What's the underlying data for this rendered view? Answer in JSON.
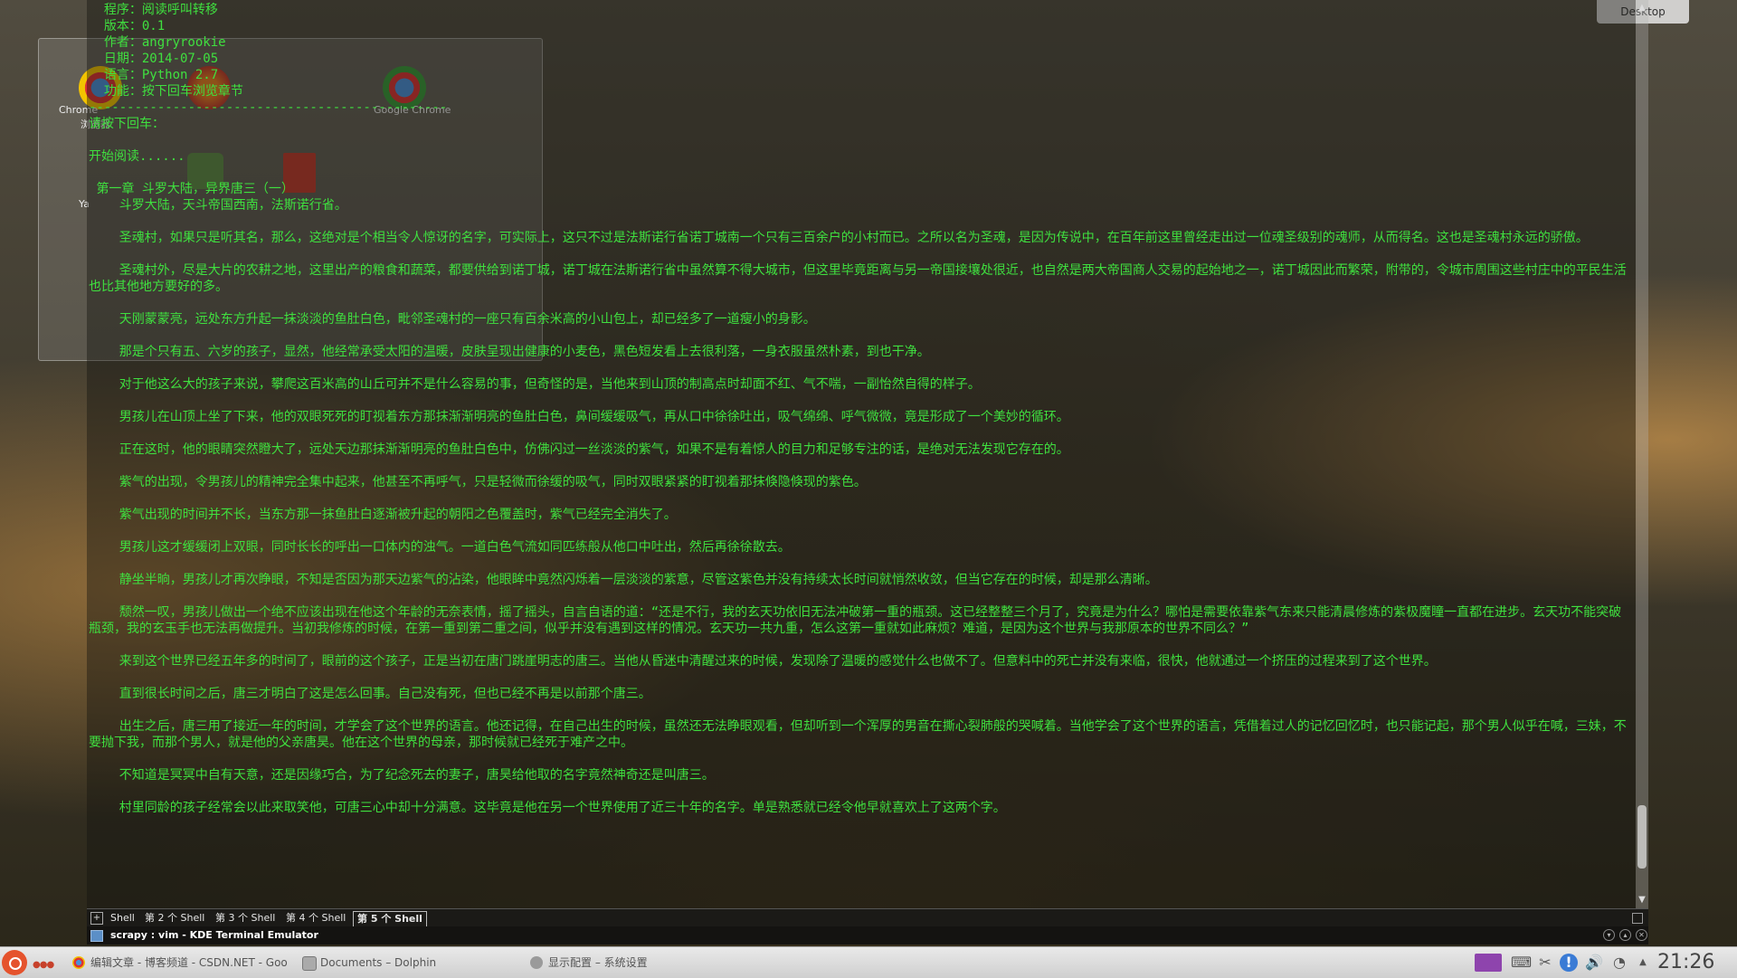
{
  "desktop": {
    "folder_view_labels": [
      "Chrome",
      "浏览器",
      "Ya",
      "Google Chrome"
    ],
    "plasmoid_label": "Desktop"
  },
  "terminal": {
    "lines": [
      "  程序：阅读呼叫转移",
      "  版本：0.1",
      "  作者：angryrookie",
      "  日期：2014-07-05",
      "  语言：Python 2.7",
      "  功能：按下回车浏览章节",
      "-----------------------------------------------",
      "请按下回车：",
      "",
      "开始阅读......",
      "",
      " 第一章 斗罗大陆，异界唐三（一）",
      "    斗罗大陆，天斗帝国西南，法斯诺行省。",
      "",
      "    圣魂村，如果只是听其名，那么，这绝对是个相当令人惊讶的名字，可实际上，这只不过是法斯诺行省诺丁城南一个只有三百余户的小村而已。之所以名为圣魂，是因为传说中，在百年前这里曾经走出过一位魂圣级别的魂师，从而得名。这也是圣魂村永远的骄傲。",
      "",
      "    圣魂村外，尽是大片的农耕之地，这里出产的粮食和蔬菜，都要供给到诺丁城，诺丁城在法斯诺行省中虽然算不得大城市，但这里毕竟距离与另一帝国接壤处很近，也自然是两大帝国商人交易的起始地之一，诺丁城因此而繁荣，附带的，令城市周围这些村庄中的平民生活也比其他地方要好的多。",
      "",
      "    天刚蒙蒙亮，远处东方升起一抹淡淡的鱼肚白色，毗邻圣魂村的一座只有百余米高的小山包上，却已经多了一道瘦小的身影。",
      "",
      "    那是个只有五、六岁的孩子，显然，他经常承受太阳的温暖，皮肤呈现出健康的小麦色，黑色短发看上去很利落，一身衣服虽然朴素，到也干净。",
      "",
      "    对于他这么大的孩子来说，攀爬这百米高的山丘可并不是什么容易的事，但奇怪的是，当他来到山顶的制高点时却面不红、气不喘，一副怡然自得的样子。",
      "",
      "    男孩儿在山顶上坐了下来，他的双眼死死的盯视着东方那抹渐渐明亮的鱼肚白色，鼻间缓缓吸气，再从口中徐徐吐出，吸气绵绵、呼气微微，竟是形成了一个美妙的循环。",
      "",
      "    正在这时，他的眼睛突然瞪大了，远处天边那抹渐渐明亮的鱼肚白色中，仿佛闪过一丝淡淡的紫气，如果不是有着惊人的目力和足够专注的话，是绝对无法发现它存在的。",
      "",
      "    紫气的出现，令男孩儿的精神完全集中起来，他甚至不再呼气，只是轻微而徐缓的吸气，同时双眼紧紧的盯视着那抹倏隐倏现的紫色。",
      "",
      "    紫气出现的时间并不长，当东方那一抹鱼肚白逐渐被升起的朝阳之色覆盖时，紫气已经完全消失了。",
      "",
      "    男孩儿这才缓缓闭上双眼，同时长长的呼出一口体内的浊气。一道白色气流如同匹练般从他口中吐出，然后再徐徐散去。",
      "",
      "    静坐半晌，男孩儿才再次睁眼，不知是否因为那天边紫气的沾染，他眼眸中竟然闪烁着一层淡淡的紫意，尽管这紫色并没有持续太长时间就悄然收敛，但当它存在的时候，却是那么清晰。",
      "",
      "    颓然一叹，男孩儿做出一个绝不应该出现在他这个年龄的无奈表情，摇了摇头，自言自语的道：“还是不行，我的玄天功依旧无法冲破第一重的瓶颈。这已经整整三个月了，究竟是为什么？哪怕是需要依靠紫气东来只能清晨修炼的紫极魔瞳一直都在进步。玄天功不能突破瓶颈，我的玄玉手也无法再做提升。当初我修炼的时候，在第一重到第二重之间，似乎并没有遇到这样的情况。玄天功一共九重，怎么这第一重就如此麻烦？难道，是因为这个世界与我那原本的世界不同么？”",
      "",
      "    来到这个世界已经五年多的时间了，眼前的这个孩子，正是当初在唐门跳崖明志的唐三。当他从昏迷中清醒过来的时候，发现除了温暖的感觉什么也做不了。但意料中的死亡并没有来临，很快，他就通过一个挤压的过程来到了这个世界。",
      "",
      "    直到很长时间之后，唐三才明白了这是怎么回事。自己没有死，但也已经不再是以前那个唐三。",
      "",
      "    出生之后，唐三用了接近一年的时间，才学会了这个世界的语言。他还记得，在自己出生的时候，虽然还无法睁眼观看，但却听到一个浑厚的男音在撕心裂肺般的哭喊着。当他学会了这个世界的语言，凭借着过人的记忆回忆时，也只能记起，那个男人似乎在喊，三妹，不要抛下我，而那个男人，就是他的父亲唐昊。他在这个世界的母亲，那时候就已经死于难产之中。",
      "",
      "    不知道是冥冥中自有天意，还是因缘巧合，为了纪念死去的妻子，唐昊给他取的名字竟然神奇还是叫唐三。",
      "",
      "    村里同龄的孩子经常会以此来取笑他，可唐三心中却十分满意。这毕竟是他在另一个世界使用了近三十年的名字。单是熟悉就已经令他早就喜欢上了这两个字。"
    ],
    "tabs": [
      "Shell",
      "第 2 个 Shell",
      "第 3 个 Shell",
      "第 4 个 Shell",
      "第 5 个 Shell"
    ],
    "active_tab": 4,
    "title": "scrapy : vim - KDE Terminal Emulator",
    "colors": {
      "text": "#3fe03f",
      "background": "#1a1812"
    }
  },
  "taskbar": {
    "tasks": [
      {
        "label": "编辑文章 - 博客频道 - CSDN.NET - Goo",
        "icon": "chrome-icon"
      },
      {
        "label": "Documents – Dolphin",
        "icon": "dolphin-icon"
      },
      {
        "label": "显示配置 – 系统设置",
        "icon": "system-settings-icon"
      }
    ],
    "clock": "21:26"
  }
}
